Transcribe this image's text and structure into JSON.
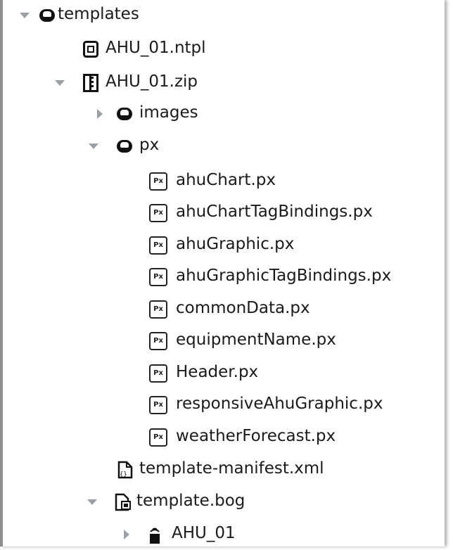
{
  "tree": {
    "rows": [
      {
        "label": "templates",
        "icon": "folder-icon",
        "toggle": "expanded"
      },
      {
        "label": "AHU_01.ntpl",
        "icon": "ntpl-file-icon",
        "toggle": "none"
      },
      {
        "label": "AHU_01.zip",
        "icon": "zip-archive-icon",
        "toggle": "expanded"
      },
      {
        "label": "images",
        "icon": "folder-icon",
        "toggle": "collapsed"
      },
      {
        "label": "px",
        "icon": "folder-icon",
        "toggle": "expanded"
      },
      {
        "label": "ahuChart.px",
        "icon": "px-file-icon",
        "toggle": "none"
      },
      {
        "label": "ahuChartTagBindings.px",
        "icon": "px-file-icon",
        "toggle": "none"
      },
      {
        "label": "ahuGraphic.px",
        "icon": "px-file-icon",
        "toggle": "none"
      },
      {
        "label": "ahuGraphicTagBindings.px",
        "icon": "px-file-icon",
        "toggle": "none"
      },
      {
        "label": "commonData.px",
        "icon": "px-file-icon",
        "toggle": "none"
      },
      {
        "label": "equipmentName.px",
        "icon": "px-file-icon",
        "toggle": "none"
      },
      {
        "label": "Header.px",
        "icon": "px-file-icon",
        "toggle": "none"
      },
      {
        "label": "responsiveAhuGraphic.px",
        "icon": "px-file-icon",
        "toggle": "none"
      },
      {
        "label": "weatherForecast.px",
        "icon": "px-file-icon",
        "toggle": "none"
      },
      {
        "label": "template-manifest.xml",
        "icon": "xml-file-icon",
        "toggle": "none"
      },
      {
        "label": "template.bog",
        "icon": "bog-file-icon",
        "toggle": "expanded"
      },
      {
        "label": "AHU_01",
        "icon": "device-icon",
        "toggle": "collapsed"
      }
    ],
    "px_icon_text": "Px"
  }
}
